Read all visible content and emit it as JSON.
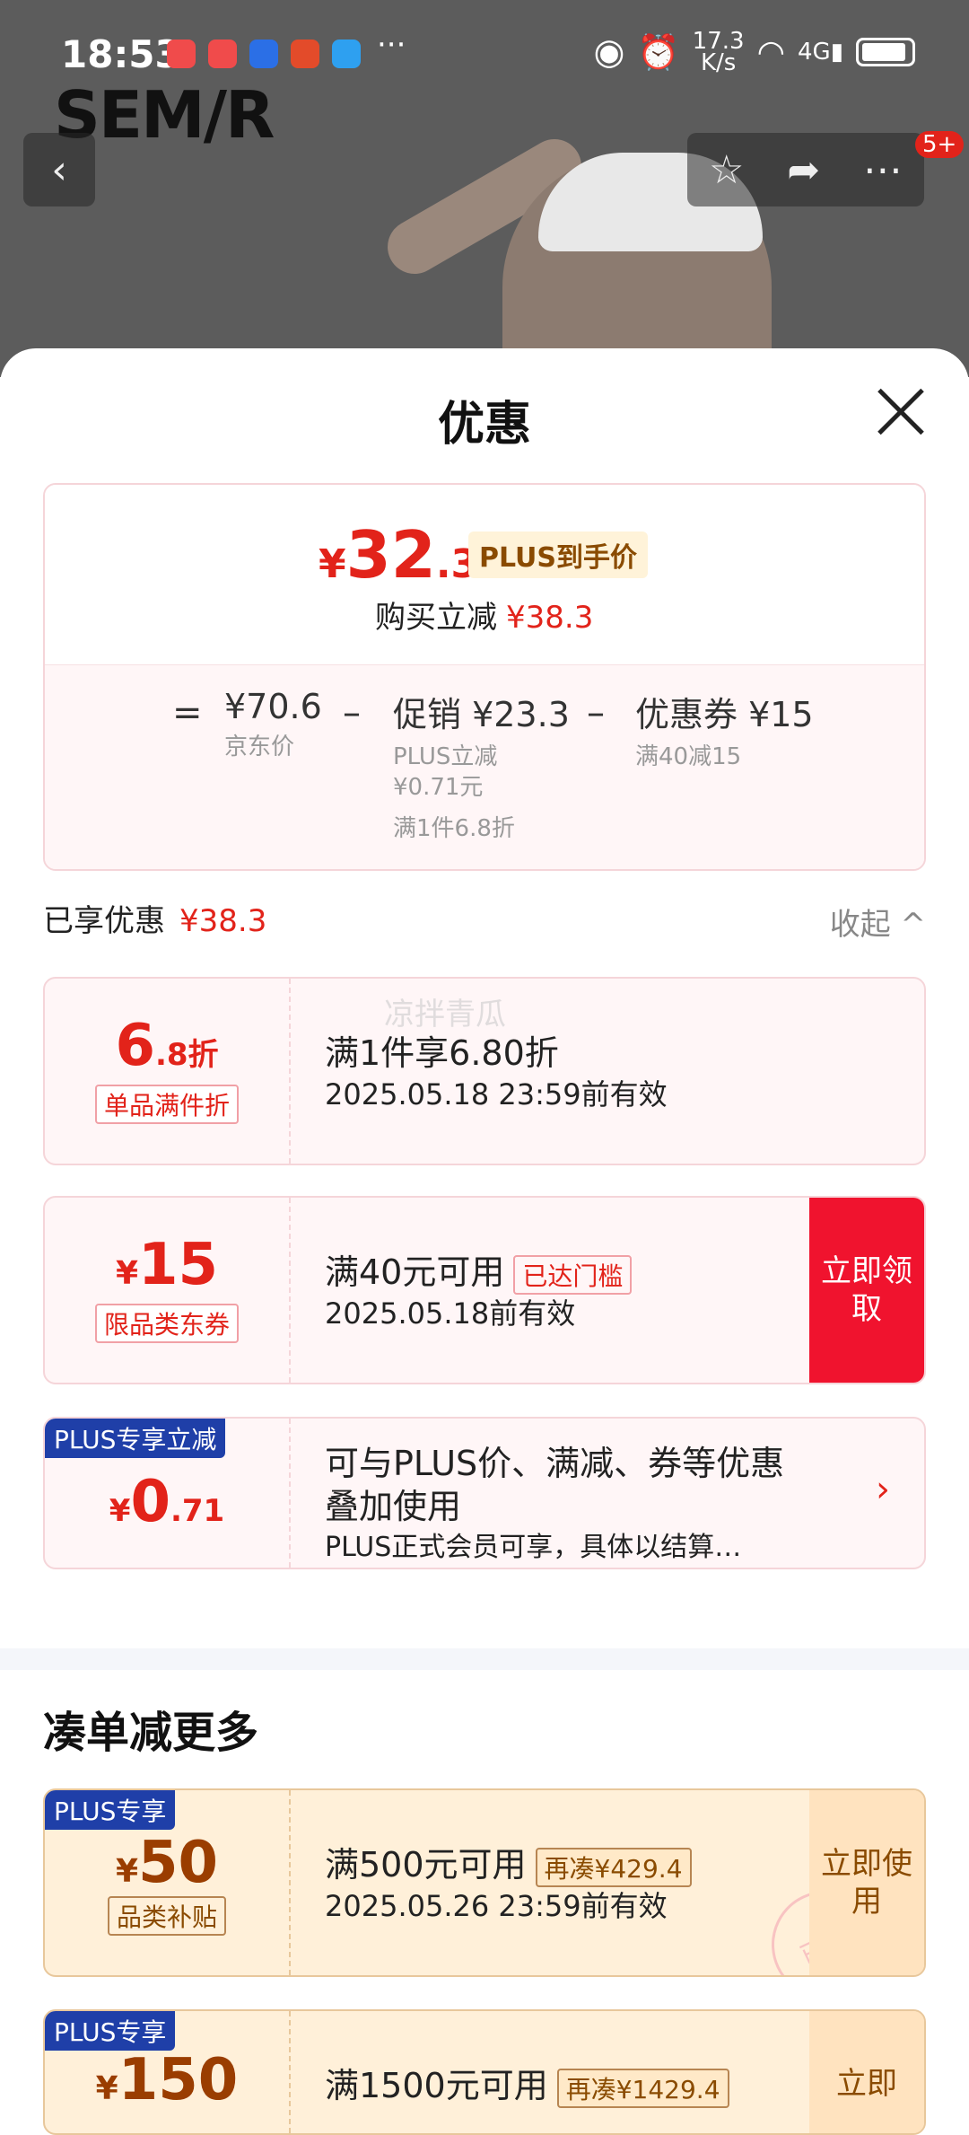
{
  "status_bar": {
    "time": "18:53",
    "speed_top": "17.3",
    "speed_bottom": "K/s",
    "net": "4G",
    "more": "···"
  },
  "background": {
    "logo": "SEM/R",
    "badge": "5+"
  },
  "sheet": {
    "title": "优惠",
    "price": {
      "yen": "¥",
      "int": "32",
      "dec": ".3",
      "plus_tag": "PLUS到手价",
      "reduce_label": "购买立减",
      "reduce_amount": "¥38.3"
    },
    "formula": {
      "eq": "=",
      "jd_price": "¥70.6",
      "jd_label": "京东价",
      "minus1": "–",
      "promo": "促销 ¥23.3",
      "promo_sub1": "PLUS立减",
      "promo_sub2": "¥0.71元",
      "promo_sub3": "满1件6.8折",
      "minus2": "–",
      "coupon": "优惠券 ¥15",
      "coupon_sub": "满40减15"
    },
    "enjoyed": {
      "label": "已享优惠",
      "amount": "¥38.3",
      "collapse": "收起 ^"
    },
    "watermark": "凉拌青瓜",
    "cards": [
      {
        "left_val": "6",
        "left_unit": ".8折",
        "left_tag": "单品满件折",
        "line1": "满1件享6.80折",
        "line2": "2025.05.18 23:59前有效"
      },
      {
        "left_yen": "¥",
        "left_val": "15",
        "left_tag": "限品类东券",
        "line1": "满40元可用",
        "chip": "已达门槛",
        "line2": "2025.05.18前有效",
        "button": "立即领取"
      },
      {
        "corner": "PLUS专享立减",
        "left_yen": "¥",
        "left_val": "0",
        "left_dec": ".71",
        "line1": "可与PLUS价、满减、券等优惠",
        "line1b": "叠加使用",
        "line2": "PLUS正式会员可享，具体以结算…",
        "chev": "›"
      }
    ],
    "section_title": "凑单减更多",
    "more_cards": [
      {
        "corner": "PLUS专享",
        "left_yen": "¥",
        "left_val": "50",
        "left_tag": "品类补贴",
        "line1": "满500元可用",
        "chip": "再凑¥429.4",
        "line2": "2025.05.26 23:59前有效",
        "button": "立即使用",
        "stamp": "已领"
      },
      {
        "corner": "PLUS专享",
        "left_yen": "¥",
        "left_val": "150",
        "line1": "满1500元可用",
        "chip": "再凑¥1429.4",
        "button": "立即"
      }
    ]
  }
}
